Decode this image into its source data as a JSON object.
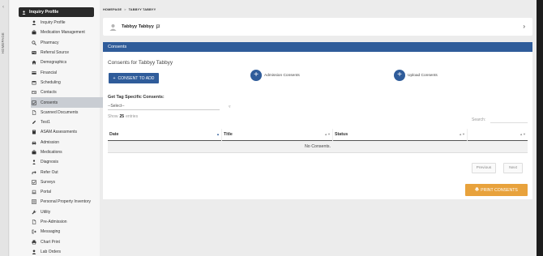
{
  "left_rail": {
    "label": "HOMEPAGE",
    "toggle_glyph": "‹"
  },
  "sidebar": {
    "header": {
      "label": "Inquiry Profile",
      "icon": "person-icon"
    },
    "items": [
      {
        "label": "Inquiry Profile",
        "icon": "person-icon"
      },
      {
        "label": "Medication Management",
        "icon": "briefcase-icon"
      },
      {
        "label": "Pharmacy",
        "icon": "search-icon"
      },
      {
        "label": "Referral Source",
        "icon": "id-card-icon"
      },
      {
        "label": "Demographics",
        "icon": "home-icon"
      },
      {
        "label": "Financial",
        "icon": "credit-card-icon"
      },
      {
        "label": "Scheduling",
        "icon": "calendar-icon"
      },
      {
        "label": "Contacts",
        "icon": "address-card-icon"
      },
      {
        "label": "Consents",
        "icon": "check-square-icon",
        "active": true
      },
      {
        "label": "Scanned Documents",
        "icon": "file-icon"
      },
      {
        "label": "Test1",
        "icon": "pencil-icon"
      },
      {
        "label": "ASAM Assessments",
        "icon": "book-icon"
      },
      {
        "label": "Admission",
        "icon": "car-icon"
      },
      {
        "label": "Medications",
        "icon": "briefcase-icon"
      },
      {
        "label": "Diagnosis",
        "icon": "person-dot-icon"
      },
      {
        "label": "Refer Out",
        "icon": "share-icon"
      },
      {
        "label": "Surveys",
        "icon": "check-square-icon"
      },
      {
        "label": "Portal",
        "icon": "laptop-icon"
      },
      {
        "label": "Personal Property Inventory",
        "icon": "list-icon"
      },
      {
        "label": "Utility",
        "icon": "wrench-icon"
      },
      {
        "label": "Pre-Admission",
        "icon": "file-icon"
      },
      {
        "label": "Messaging",
        "icon": "sign-out-icon"
      },
      {
        "label": "Chart Print",
        "icon": "print-icon"
      },
      {
        "label": "Lab Orders",
        "icon": "person-icon"
      }
    ]
  },
  "breadcrumb": {
    "home": "HOMEPAGE",
    "separator": ">",
    "current": "TABBYY TABBYY"
  },
  "patient": {
    "name": "Tabbyy Tabbyy",
    "flag_icon": "flag-icon",
    "chevron_icon": "chevron-right-icon"
  },
  "panel": {
    "header": "Consents",
    "title": "Consents for Tabbyy Tabbyy",
    "add_button": "CONSENT TO ADD",
    "admission_consents": "Admission Consents",
    "upload_consents": "Upload Consents",
    "tag_label": "Get Tag Specific Consents:",
    "tag_select": "--Select--",
    "show_prefix": "Show",
    "show_value": "25",
    "show_suffix": "entries",
    "search_label": "Search:",
    "columns": [
      "Date",
      "Title",
      "Status",
      ""
    ],
    "empty_text": "No Consents.",
    "previous": "Previous",
    "next": "Next",
    "print_button": "PRINT CONSENTS"
  },
  "colors": {
    "primary": "#2f5c9a",
    "print": "#e8a23c",
    "sidebar_head": "#2a2a2a"
  }
}
